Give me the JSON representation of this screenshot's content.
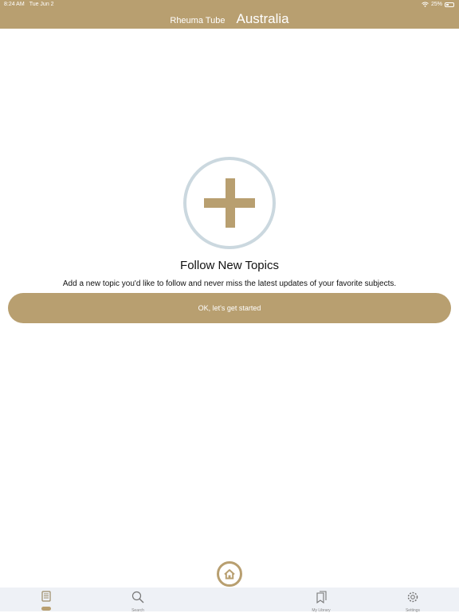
{
  "status": {
    "time": "8:24 AM",
    "date": "Tue Jun 2",
    "battery": "25%"
  },
  "header": {
    "app_name": "Rheuma Tube",
    "region": "Australia"
  },
  "empty_state": {
    "headline": "Follow New Topics",
    "description": "Add a new topic you'd like to follow and never miss the latest updates of your favorite subjects.",
    "cta_label": "OK, let's get started"
  },
  "tabs": [
    {
      "label": "",
      "icon": "news-icon",
      "selected": true
    },
    {
      "label": "Search",
      "icon": "search-icon"
    },
    {
      "label": "My Library",
      "icon": "library-icon"
    },
    {
      "label": "Settings",
      "icon": "gear-icon"
    }
  ],
  "colors": {
    "brand": "#b89f70",
    "circle_border": "#cbd8df",
    "tabbar_bg": "#eef1f6"
  }
}
